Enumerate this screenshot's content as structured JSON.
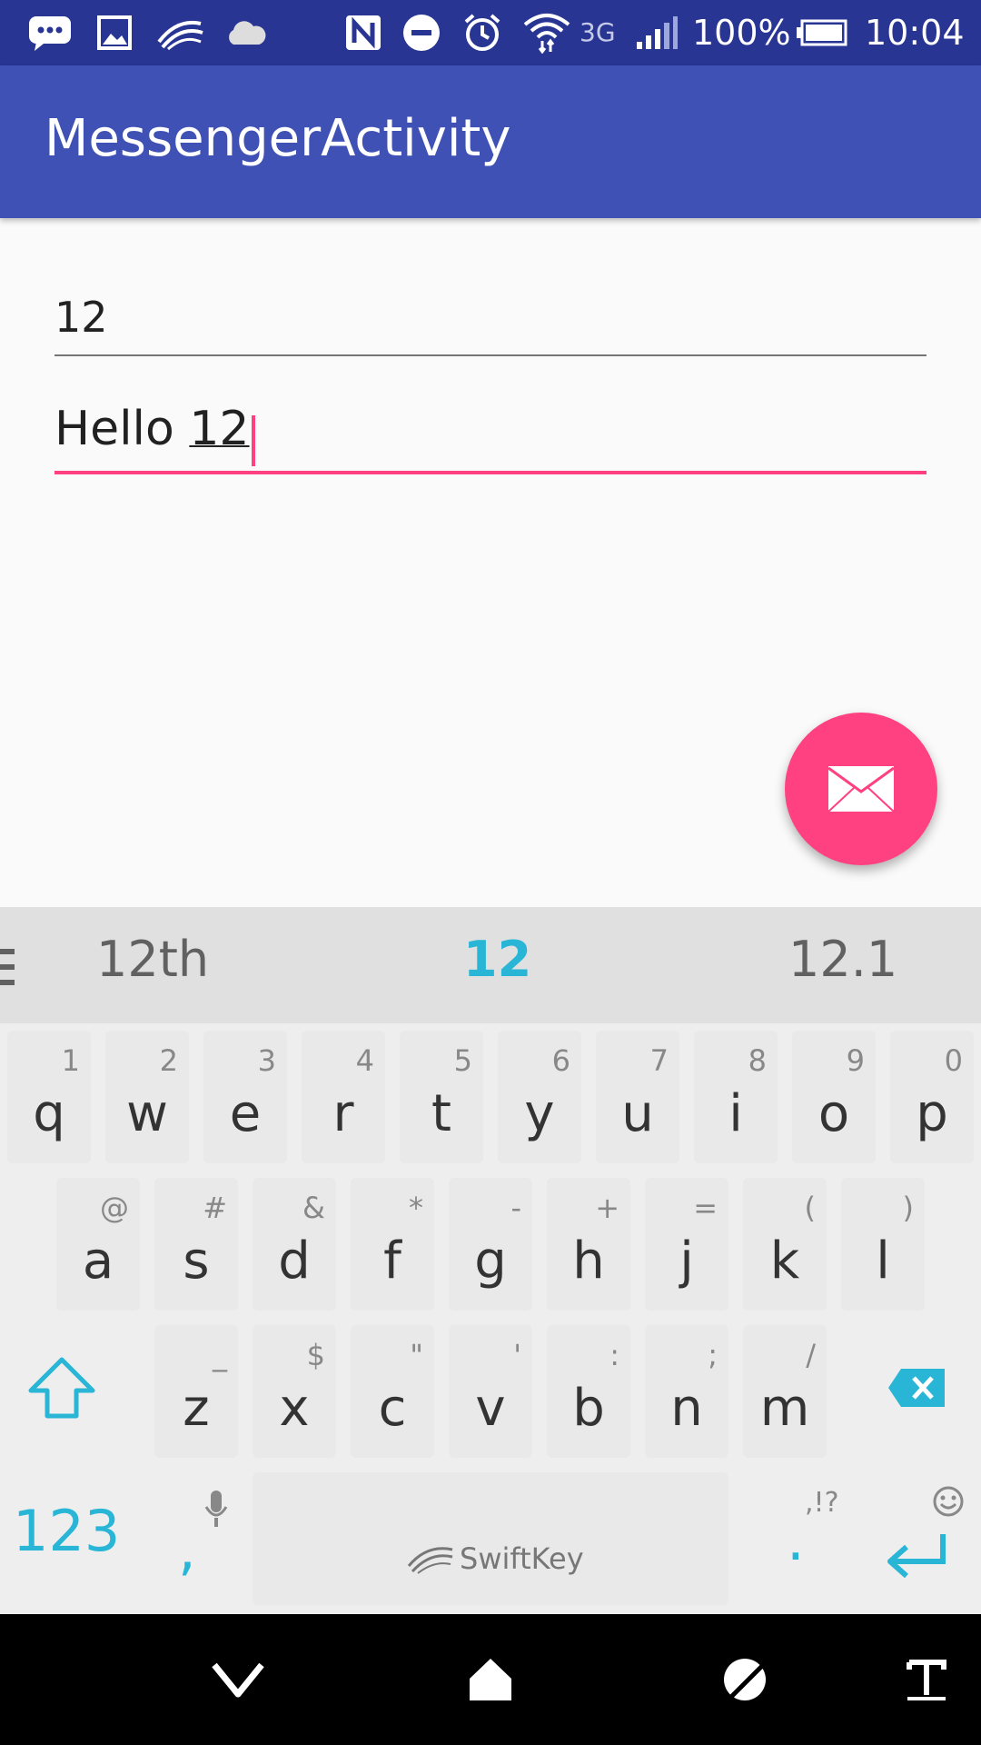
{
  "status_bar": {
    "battery": "100%",
    "time": "10:04",
    "network": "3G",
    "icons": [
      "message-icon",
      "image-icon",
      "swiftkey-icon",
      "cloud-icon",
      "nfc-icon",
      "do-not-disturb-icon",
      "alarm-icon",
      "wifi-icon",
      "signal-icon",
      "battery-icon"
    ]
  },
  "app_bar": {
    "title": "MessengerActivity"
  },
  "form": {
    "number_value": "12",
    "message_prefix": "Hello ",
    "message_composing": "12"
  },
  "fab": {
    "icon": "mail-icon",
    "color": "#ff4081"
  },
  "keyboard": {
    "suggestions": [
      "12th",
      "12",
      "12.1"
    ],
    "row1": [
      {
        "key": "q",
        "hint": "1"
      },
      {
        "key": "w",
        "hint": "2"
      },
      {
        "key": "e",
        "hint": "3"
      },
      {
        "key": "r",
        "hint": "4"
      },
      {
        "key": "t",
        "hint": "5"
      },
      {
        "key": "y",
        "hint": "6"
      },
      {
        "key": "u",
        "hint": "7"
      },
      {
        "key": "i",
        "hint": "8"
      },
      {
        "key": "o",
        "hint": "9"
      },
      {
        "key": "p",
        "hint": "0"
      }
    ],
    "row2": [
      {
        "key": "a",
        "hint": "@"
      },
      {
        "key": "s",
        "hint": "#"
      },
      {
        "key": "d",
        "hint": "&"
      },
      {
        "key": "f",
        "hint": "*"
      },
      {
        "key": "g",
        "hint": "-"
      },
      {
        "key": "h",
        "hint": "+"
      },
      {
        "key": "j",
        "hint": "="
      },
      {
        "key": "k",
        "hint": "("
      },
      {
        "key": "l",
        "hint": ")"
      }
    ],
    "row3": [
      {
        "key": "z",
        "hint": "_"
      },
      {
        "key": "x",
        "hint": "$"
      },
      {
        "key": "c",
        "hint": "\""
      },
      {
        "key": "v",
        "hint": "'"
      },
      {
        "key": "b",
        "hint": ":"
      },
      {
        "key": "n",
        "hint": ";"
      },
      {
        "key": "m",
        "hint": "/"
      }
    ],
    "numbers_label": "123",
    "comma_label": ",",
    "period_label": ".",
    "punct_hint": ",!?",
    "space_brand": "SwiftKey",
    "accent_color": "#29b6d6"
  },
  "nav_bar": {
    "icons": [
      "back-icon",
      "home-icon",
      "recents-icon",
      "text-tool-icon"
    ]
  }
}
